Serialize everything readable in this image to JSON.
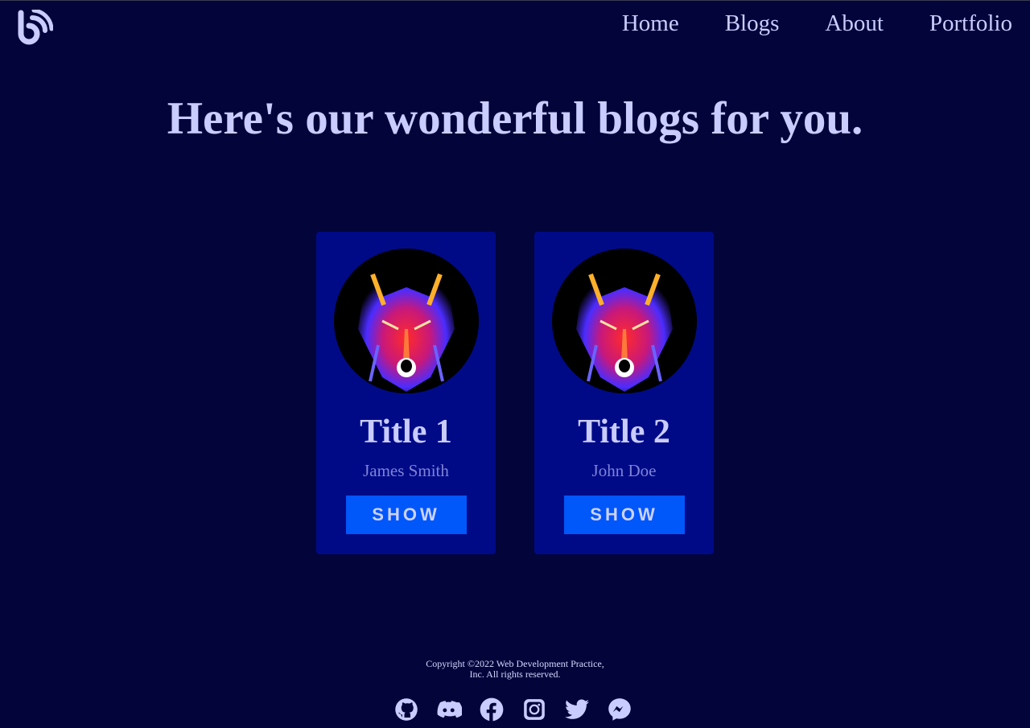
{
  "nav": {
    "items": [
      {
        "label": "Home"
      },
      {
        "label": "Blogs"
      },
      {
        "label": "About"
      },
      {
        "label": "Portfolio"
      }
    ]
  },
  "hero": {
    "title": "Here's our wonderful blogs for you."
  },
  "cards": [
    {
      "title": "Title 1",
      "author": "James Smith",
      "button": "SHOW",
      "image_icon": "neon-wolf-image"
    },
    {
      "title": "Title 2",
      "author": "John Doe",
      "button": "SHOW",
      "image_icon": "neon-wolf-image"
    }
  ],
  "footer": {
    "copyright_line1": "Copyright ©2022 Web Development Practice,",
    "copyright_line2": "Inc. All rights reserved.",
    "socials": [
      "github-icon",
      "discord-icon",
      "facebook-icon",
      "instagram-icon",
      "twitter-icon",
      "messenger-icon"
    ]
  },
  "colors": {
    "background": "#03043a",
    "card": "#000a87",
    "button": "#0057fa",
    "text": "#c9ccff",
    "author": "#7d84d6"
  }
}
